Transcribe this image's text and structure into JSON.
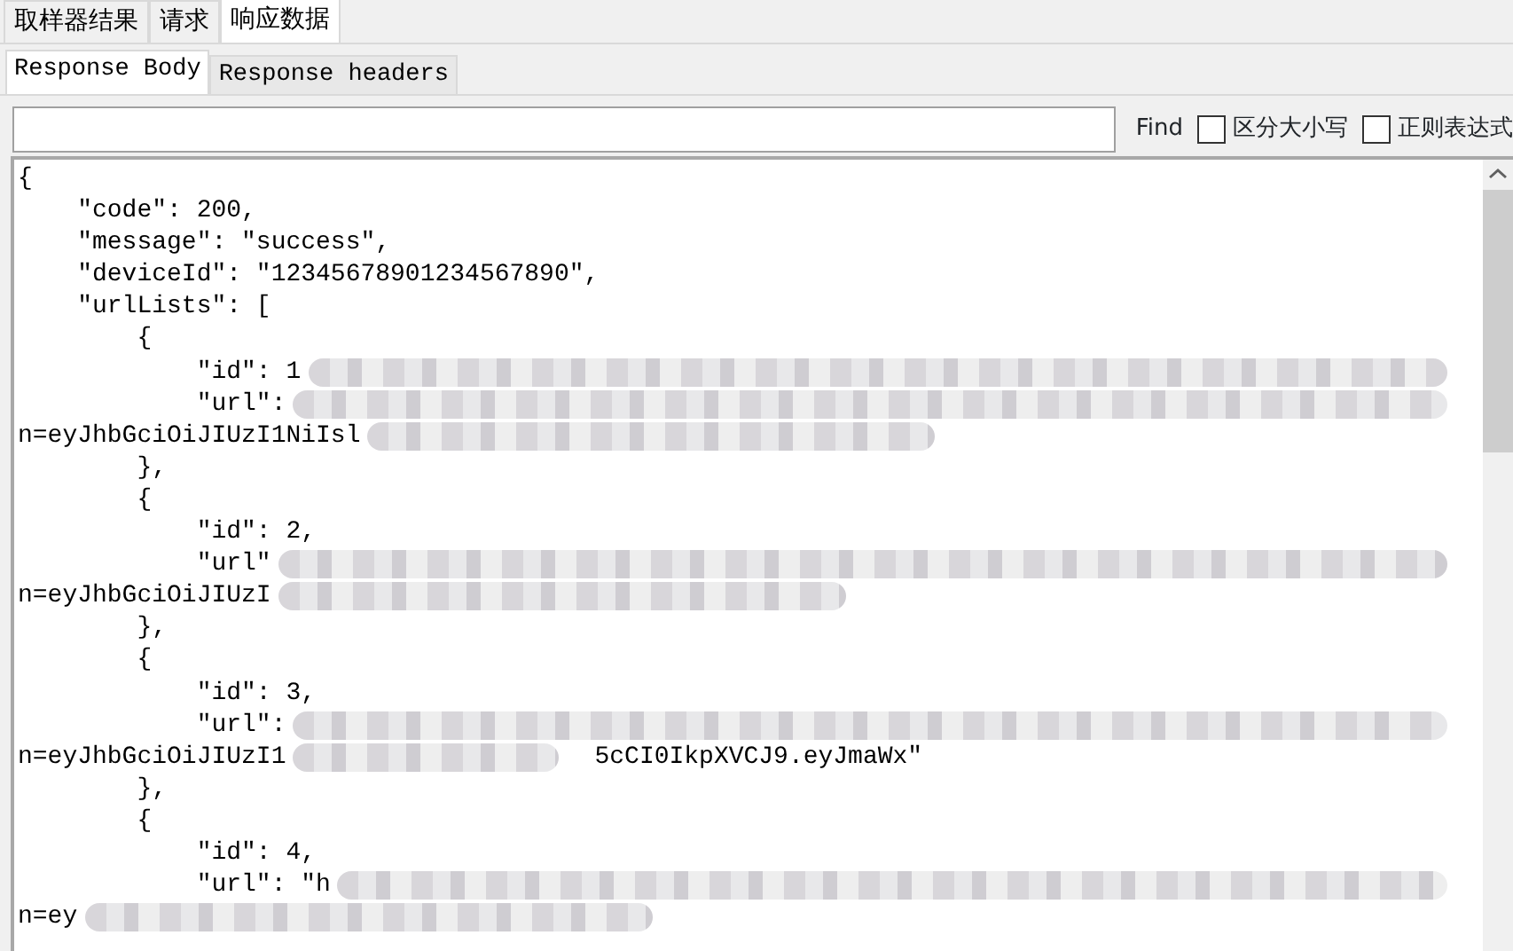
{
  "tabs": [
    {
      "label": "取样器结果",
      "selected": false
    },
    {
      "label": "请求",
      "selected": false
    },
    {
      "label": "响应数据",
      "selected": true
    }
  ],
  "subtabs": [
    {
      "label": "Response Body",
      "selected": true
    },
    {
      "label": "Response headers",
      "selected": false
    }
  ],
  "search": {
    "find_label": "Find",
    "options": [
      {
        "label": "区分大小写",
        "checked": false
      },
      {
        "label": "正则表达式",
        "checked": false
      }
    ]
  },
  "body_lines": [
    {
      "text": "{"
    },
    {
      "text": "    \"code\": 200,"
    },
    {
      "text": "    \"message\": \"success\","
    },
    {
      "text": "    \"deviceId\": \"12345678901234567890\","
    },
    {
      "text": "    \"urlLists\": ["
    },
    {
      "text": "        {"
    },
    {
      "text": "            \"id\": 1",
      "redacted": true
    },
    {
      "text": "            \"url\":",
      "redacted": true
    },
    {
      "text": "n=eyJhbGciOiJIUzI1NiIsl",
      "redacted": true,
      "short": true
    },
    {
      "text": "        },"
    },
    {
      "text": "        {"
    },
    {
      "text": "            \"id\": 2,"
    },
    {
      "text": "            \"url\"",
      "redacted": true
    },
    {
      "text": "n=eyJhbGciOiJIUzI",
      "redacted": true,
      "short": true
    },
    {
      "text": "        },"
    },
    {
      "text": "        {"
    },
    {
      "text": "            \"id\": 3,"
    },
    {
      "text": "            \"url\":",
      "redacted": true
    },
    {
      "text": "n=eyJhbGciOiJIUzI1",
      "redacted": true,
      "tail": "5cCI0IkpXVCJ9.eyJmaWx\""
    },
    {
      "text": "        },"
    },
    {
      "text": "        {"
    },
    {
      "text": "            \"id\": 4,"
    },
    {
      "text": "            \"url\": \"h",
      "redacted": true
    },
    {
      "text": "n=ey",
      "redacted": true,
      "short": true
    }
  ]
}
